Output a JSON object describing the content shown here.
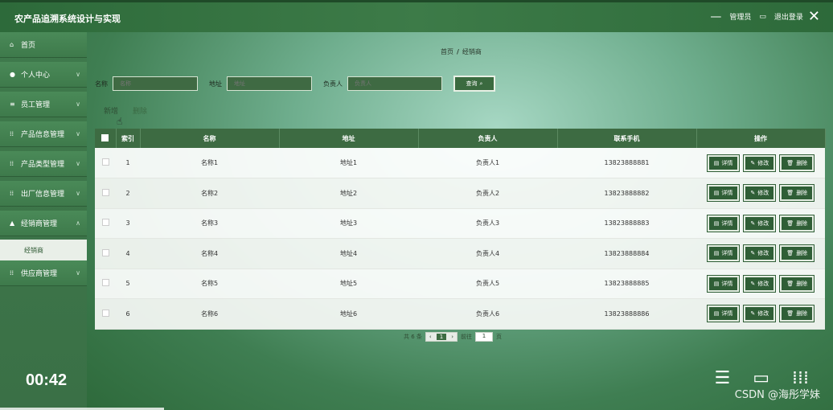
{
  "header": {
    "app_title": "农产品追溯系统设计与实现",
    "user_label": "管理员",
    "logout_label": "退出登录"
  },
  "sidebar": {
    "items": [
      {
        "label": "首页",
        "icon": "home-icon",
        "has_chevron": false
      },
      {
        "label": "个人中心",
        "icon": "user-icon",
        "has_chevron": true
      },
      {
        "label": "员工管理",
        "icon": "list-icon",
        "has_chevron": true
      },
      {
        "label": "产品信息管理",
        "icon": "grid-icon",
        "has_chevron": true
      },
      {
        "label": "产品类型管理",
        "icon": "grid-icon",
        "has_chevron": true
      },
      {
        "label": "出厂信息管理",
        "icon": "grid-icon",
        "has_chevron": true
      },
      {
        "label": "经销商管理",
        "icon": "chart-icon",
        "has_chevron": true
      }
    ],
    "sub_item": "经销商",
    "after_item": {
      "label": "供应商管理",
      "icon": "grid-icon",
      "has_chevron": true
    }
  },
  "breadcrumb": {
    "home": "首页",
    "current": "经销商"
  },
  "search": {
    "name_label": "名称",
    "name_placeholder": "名称",
    "addr_label": "地址",
    "addr_placeholder": "地址",
    "person_label": "负责人",
    "person_placeholder": "负责人",
    "button_label": "查询"
  },
  "actions": {
    "add": "新增",
    "delete": "删除"
  },
  "table": {
    "headers": [
      "索引",
      "名称",
      "地址",
      "负责人",
      "联系手机",
      "操作"
    ],
    "rows": [
      {
        "index": "1",
        "name": "名称1",
        "addr": "地址1",
        "person": "负责人1",
        "phone": "13823888881"
      },
      {
        "index": "2",
        "name": "名称2",
        "addr": "地址2",
        "person": "负责人2",
        "phone": "13823888882"
      },
      {
        "index": "3",
        "name": "名称3",
        "addr": "地址3",
        "person": "负责人3",
        "phone": "13823888883"
      },
      {
        "index": "4",
        "name": "名称4",
        "addr": "地址4",
        "person": "负责人4",
        "phone": "13823888884"
      },
      {
        "index": "5",
        "name": "名称5",
        "addr": "地址5",
        "person": "负责人5",
        "phone": "13823888885"
      },
      {
        "index": "6",
        "name": "名称6",
        "addr": "地址6",
        "person": "负责人6",
        "phone": "13823888886"
      }
    ],
    "op_detail": "详情",
    "op_edit": "修改",
    "op_delete": "删除"
  },
  "pager": {
    "total": "共 6 条",
    "page": "1",
    "goto_prefix": "前往",
    "goto_value": "1",
    "goto_suffix": "页"
  },
  "video": {
    "time": "00:42"
  },
  "watermark": "CSDN @海彤学妹",
  "colors": {
    "primary": "#3d6b42",
    "sidebar": "#3e7a4b",
    "header": "#2d6a3a"
  }
}
